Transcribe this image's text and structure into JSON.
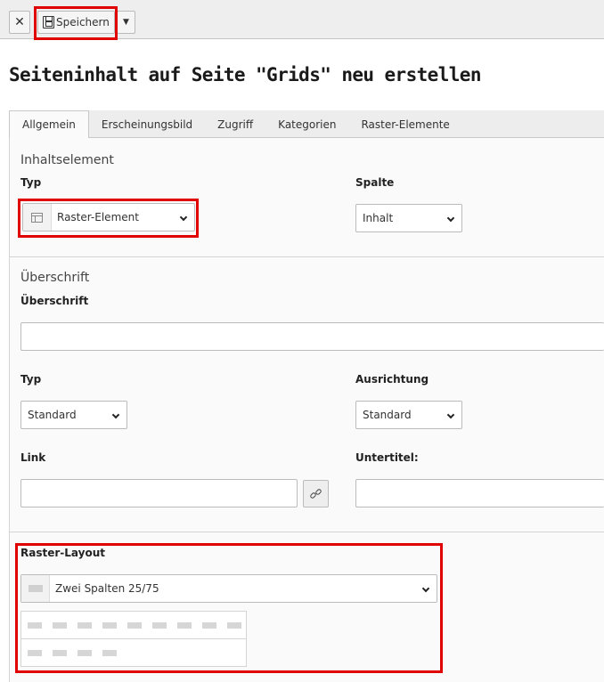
{
  "toolbar": {
    "close_icon": "close-icon",
    "save_label": "Speichern",
    "save_icon": "floppy-disk-icon",
    "dropdown_icon": "caret-down-icon"
  },
  "page": {
    "title": "Seiteninhalt auf Seite \"Grids\" neu erstellen"
  },
  "tabs": [
    {
      "label": "Allgemein",
      "active": true
    },
    {
      "label": "Erscheinungsbild"
    },
    {
      "label": "Zugriff"
    },
    {
      "label": "Kategorien"
    },
    {
      "label": "Raster-Elemente"
    }
  ],
  "content_element": {
    "section_title": "Inhaltselement",
    "type_label": "Typ",
    "type_value": "Raster-Element",
    "type_icon": "grid-element-icon",
    "column_label": "Spalte",
    "column_value": "Inhalt"
  },
  "header": {
    "section_title": "Überschrift",
    "header_label": "Überschrift",
    "header_value": "",
    "type_label": "Typ",
    "type_value": "Standard",
    "alignment_label": "Ausrichtung",
    "alignment_value": "Standard",
    "link_label": "Link",
    "link_value": "",
    "link_icon": "link-icon",
    "subtitle_label": "Untertitel:",
    "subtitle_value": ""
  },
  "grid_layout": {
    "label": "Raster-Layout",
    "value": "Zwei Spalten 25/75",
    "icon": "layout-icon"
  },
  "colors": {
    "highlight": "#e00000",
    "toolbar_bg": "#eeeeee",
    "panel_bg": "#fafafa"
  }
}
